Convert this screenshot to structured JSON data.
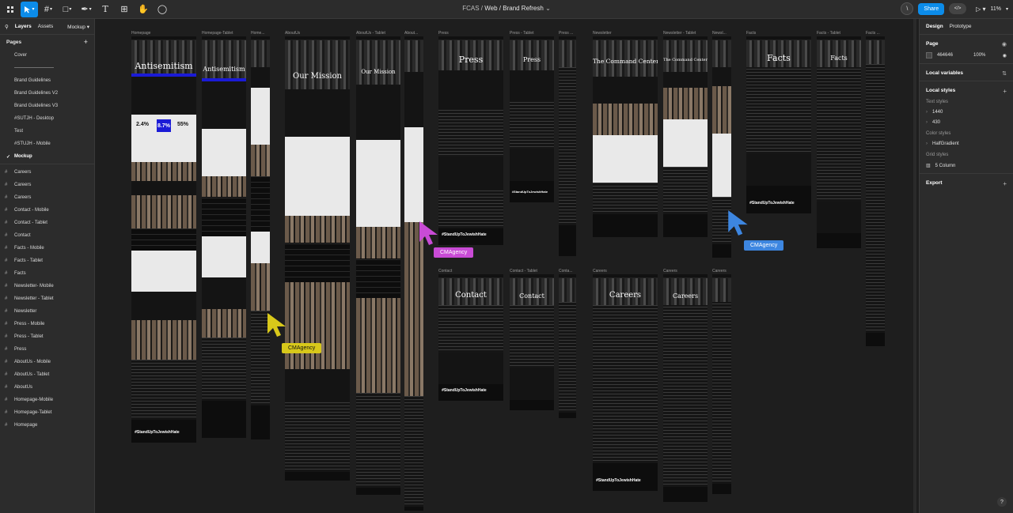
{
  "window": {
    "file": "FCAS",
    "separator": "/",
    "page": "Web / Brand Refresh"
  },
  "toolbar": {
    "share_label": "Share",
    "zoom": "11%",
    "user_initial": "\\",
    "dev_mode": "</>"
  },
  "left_panel": {
    "tabs": [
      "Layers",
      "Assets"
    ],
    "current_page": "Mockup",
    "pages_title": "Pages",
    "pages": [
      "Cover",
      "-------------------------",
      "Brand Guidelines",
      "Brand Guidelines V2",
      "Brand Guidelines V3",
      "#SUTJH - Desktop",
      "Test",
      "#STUJH - Mobile",
      "Mockup"
    ],
    "layers": [
      "Careers",
      "Careers",
      "Careers",
      "Contact - Mobile",
      "Contact - Tablet",
      "Contact",
      "Facts - Mobile",
      "Facts - Tablet",
      "Facts",
      "Newsletter- Mobile",
      "Newsletter - Tablet",
      "Newsletter",
      "Press - Mobile",
      "Press - Tablet",
      "Press",
      "AboutUs - Mobile",
      "AboutUs - Tablet",
      "AboutUs",
      "Homepage-Mobile",
      "Homepage-Tablet",
      "Homepage"
    ]
  },
  "canvas": {
    "frame_labels": {
      "home": "Homepage",
      "home_tablet": "Homepage-Tablet",
      "home_mobile": "Home...",
      "about": "AboutUs",
      "about_tablet": "AboutUs - Tablet",
      "about_mobile": "About...",
      "press": "Press",
      "press_tablet": "Press - Tablet",
      "press_mobile": "Press ...",
      "news": "Newsletter",
      "news_tablet": "Newsletter - Tablet",
      "news_mobile": "Newsl...",
      "facts": "Facts",
      "facts_tablet": "Facts - Tablet",
      "facts_mobile": "Facts ...",
      "contact": "Contact",
      "contact_tablet": "Contact - Tablet",
      "contact_mobile": "Conta...",
      "careers": "Careers",
      "careers_tablet": "Careers",
      "careers_mobile": "Careers"
    },
    "headings": {
      "antisemitism": "Antisemitism",
      "mission": "Our Mission",
      "press": "Press",
      "command": "The Command Center",
      "facts": "Facts",
      "contact": "Contact",
      "careers": "Careers",
      "hashtag": "#StandUpToJewishHate",
      "stat1": "2.4%",
      "stat2": "8.7%",
      "stat3": "55%"
    },
    "tags": {
      "yellow": "CMAgency",
      "purple": "CMAgency",
      "blue": "CMAgency"
    },
    "colors": {
      "yellow": "#d8c81a",
      "purple": "#c94bd6",
      "blue": "#3d86e0",
      "accent": "#0c8ce9"
    }
  },
  "right_panel": {
    "tabs": [
      "Design",
      "Prototype"
    ],
    "page_title": "Page",
    "bg_hex": "464646",
    "bg_opacity": "100%",
    "local_variables": "Local variables",
    "local_styles": "Local styles",
    "text_styles": "Text styles",
    "text_style_items": [
      "1440",
      "430"
    ],
    "color_styles": "Color styles",
    "color_style_items": [
      "HalfGradient"
    ],
    "grid_styles": "Grid styles",
    "grid_style_items": [
      "5 Column"
    ],
    "export": "Export",
    "help": "?"
  }
}
